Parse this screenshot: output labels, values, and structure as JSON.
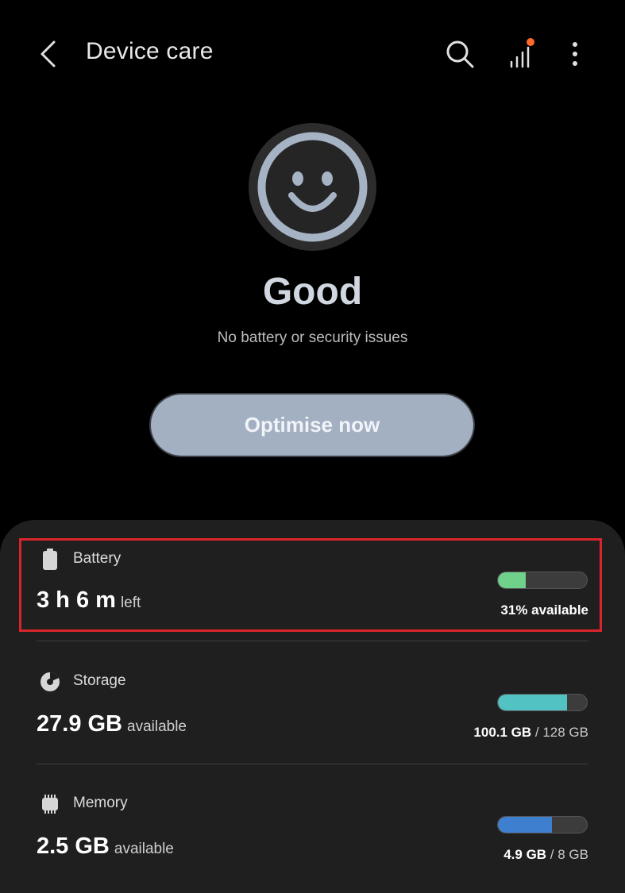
{
  "header": {
    "title": "Device care",
    "back_icon": "back-arrow-icon",
    "search_icon": "search-icon",
    "stats_icon": "bar-chart-icon",
    "more_icon": "more-vertical-icon"
  },
  "status": {
    "title": "Good",
    "subtitle": "No battery or security issues",
    "icon": "smiley-face-icon"
  },
  "optimise_button": {
    "label": "Optimise now"
  },
  "items": [
    {
      "label": "Battery",
      "icon": "battery-icon",
      "value": "3 h 6 m",
      "value_suffix": "left",
      "level": 0.31,
      "color": "#6fd18a",
      "caption_strong": "31% available",
      "caption_rest": ""
    },
    {
      "label": "Storage",
      "icon": "storage-pie-icon",
      "value": "27.9 GB",
      "value_suffix": "available",
      "level": 0.78,
      "color": "#52c3c2",
      "caption_strong": "100.1 GB",
      "caption_rest": " / 128 GB"
    },
    {
      "label": "Memory",
      "icon": "memory-chip-icon",
      "value": "2.5 GB",
      "value_suffix": "available",
      "level": 0.61,
      "color": "#3f7fd0",
      "caption_strong": "4.9 GB",
      "caption_rest": " / 8 GB"
    }
  ],
  "colors": {
    "accent_button": "#a3b0c2",
    "highlight": "#d9242b",
    "notification_dot": "#ff6a2a",
    "panel": "#1f1f1f"
  }
}
